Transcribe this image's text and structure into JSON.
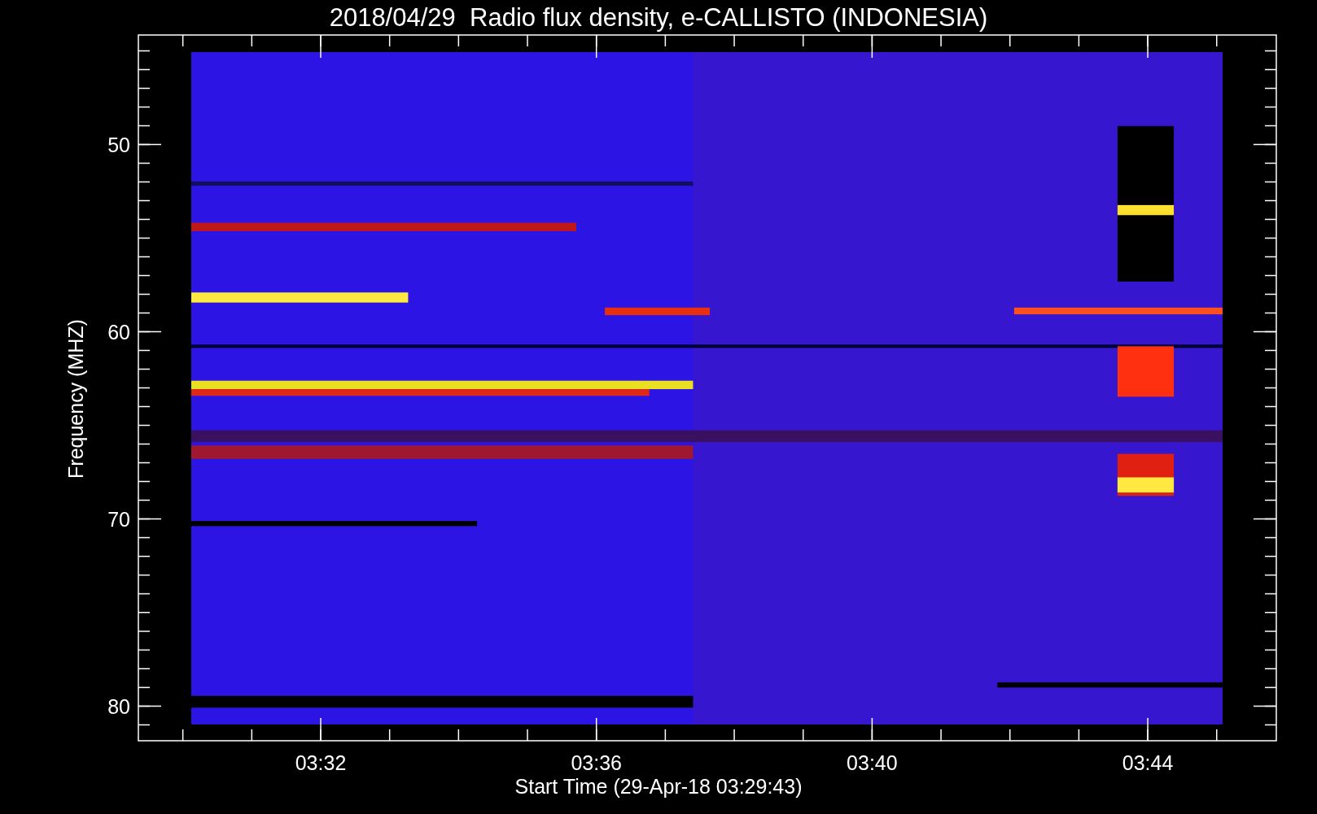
{
  "title": "2018/04/29  Radio flux density, e-CALLISTO (INDONESIA)",
  "plot": {
    "ylabel": "Frequency (MHZ)",
    "yticks": [
      "50",
      "60",
      "70",
      "80"
    ],
    "xticks": [
      "03:32",
      "03:36",
      "03:40",
      "03:44"
    ],
    "xlabel": "Start Time (29-Apr-18 03:29:43)"
  }
}
